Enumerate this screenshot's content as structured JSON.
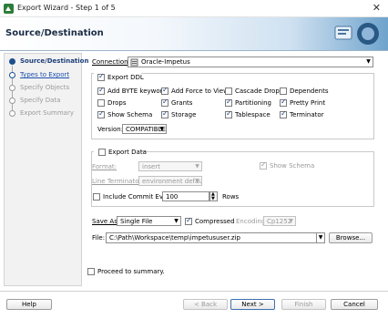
{
  "window": {
    "title": "Export Wizard - Step 1 of 5"
  },
  "header": {
    "title": "Source/Destination"
  },
  "steps": [
    {
      "label": "Source/Destination",
      "state": "current"
    },
    {
      "label": "Types to Export",
      "state": "link"
    },
    {
      "label": "Specify Objects",
      "state": "disabled"
    },
    {
      "label": "Specify Data",
      "state": "disabled"
    },
    {
      "label": "Export Summary",
      "state": "disabled"
    }
  ],
  "connection": {
    "label": "Connection:",
    "value": "Oracle-Impetus"
  },
  "export_ddl": {
    "label": "Export DDL",
    "checked": true,
    "options": [
      {
        "label": "Add BYTE keyword",
        "checked": true
      },
      {
        "label": "Add Force to Views",
        "checked": true
      },
      {
        "label": "Cascade Drops",
        "checked": false
      },
      {
        "label": "Dependents",
        "checked": false
      },
      {
        "label": "Drops",
        "checked": false
      },
      {
        "label": "Grants",
        "checked": true
      },
      {
        "label": "Partitioning",
        "checked": true
      },
      {
        "label": "Pretty Print",
        "checked": true
      },
      {
        "label": "Show Schema",
        "checked": true
      },
      {
        "label": "Storage",
        "checked": true
      },
      {
        "label": "Tablespace",
        "checked": true
      },
      {
        "label": "Terminator",
        "checked": true
      }
    ],
    "version_label": "Version:",
    "version_value": "COMPATIBLE"
  },
  "export_data": {
    "label": "Export Data",
    "checked": false,
    "format_label": "Format:",
    "format_value": "insert",
    "show_schema_label": "Show Schema",
    "line_terminator_label": "Line Terminator:",
    "line_terminator_value": "environment default",
    "commit_label": "Include Commit Every",
    "commit_value": "100",
    "rows_label": "Rows"
  },
  "save": {
    "label": "Save As",
    "value": "Single File",
    "compressed_label": "Compressed",
    "encoding_label": "Encoding:",
    "encoding_value": "Cp1252",
    "file_label": "File:",
    "file_value": "C:\\Path\\Workspace\\temp\\impetususer.zip",
    "browse_label": "Browse..."
  },
  "proceed_label": "Proceed to summary.",
  "buttons": {
    "help": "Help",
    "back": "< Back",
    "next": "Next >",
    "finish": "Finish",
    "cancel": "Cancel"
  }
}
